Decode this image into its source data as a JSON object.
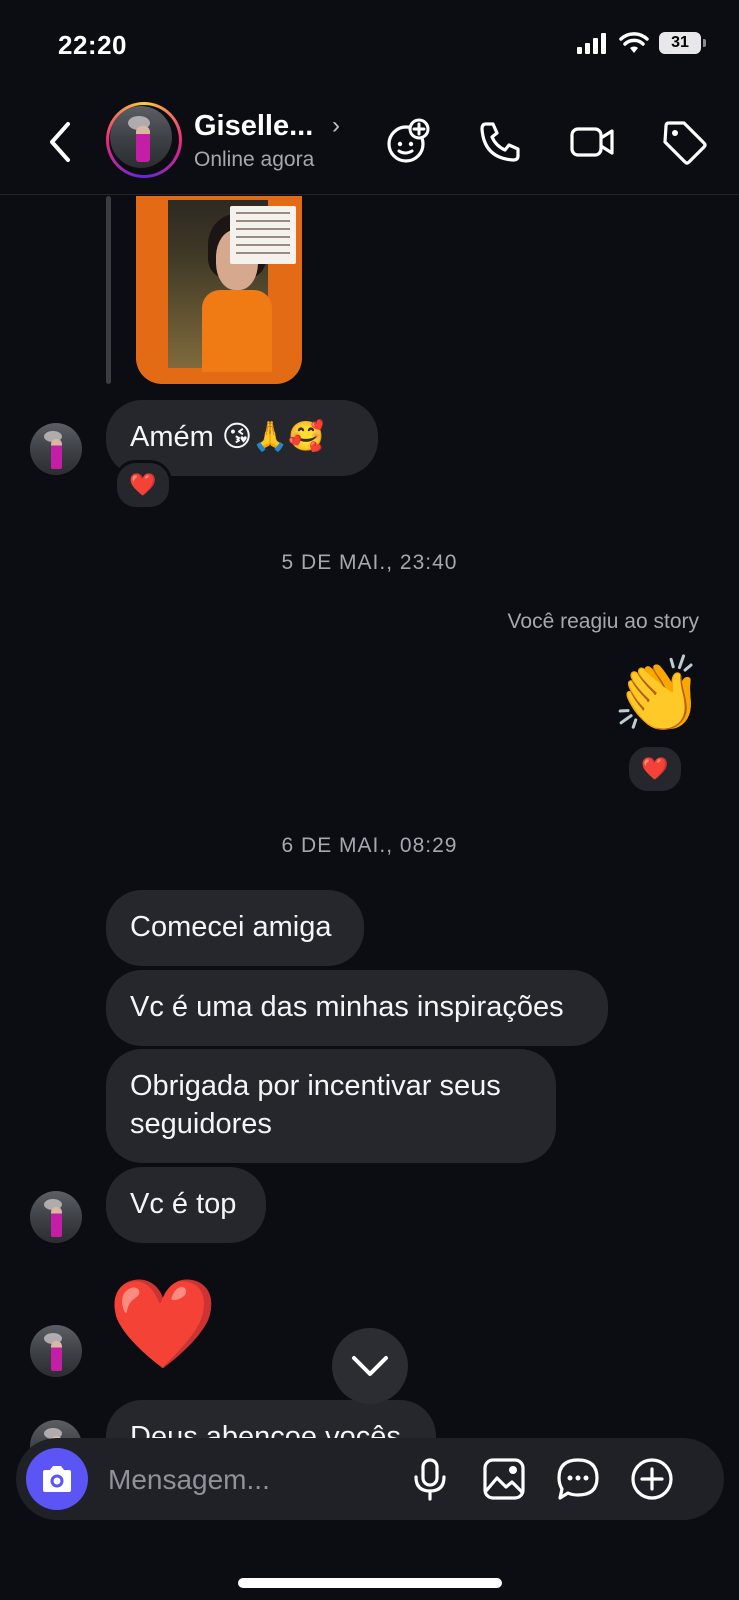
{
  "status_bar": {
    "time": "22:20",
    "battery": "31"
  },
  "header": {
    "contact_name": "Giselle...",
    "contact_status": "Online agora"
  },
  "chat": {
    "messages": [
      {
        "text": "Amém 😘🙏🥰",
        "reaction": "❤️"
      },
      {
        "type": "timestamp",
        "text": "5 DE MAI., 23:40"
      },
      {
        "type": "system",
        "text": "Você reagiu ao story"
      },
      {
        "type": "emoji",
        "text": "👏",
        "reaction": "❤️"
      },
      {
        "type": "timestamp",
        "text": "6 DE MAI., 08:29"
      },
      {
        "text": "Comecei amiga"
      },
      {
        "text": "Vc é uma das minhas inspirações"
      },
      {
        "text": "Obrigada por incentivar seus seguidores"
      },
      {
        "text": "Vc é top"
      },
      {
        "type": "emoji",
        "text": "❤️"
      },
      {
        "text": "Deus abençoe vocês"
      }
    ]
  },
  "composer": {
    "placeholder": "Mensagem..."
  },
  "colors": {
    "accent": "#5b55f5",
    "bubble": "#25272d",
    "background": "#0c0d12"
  }
}
